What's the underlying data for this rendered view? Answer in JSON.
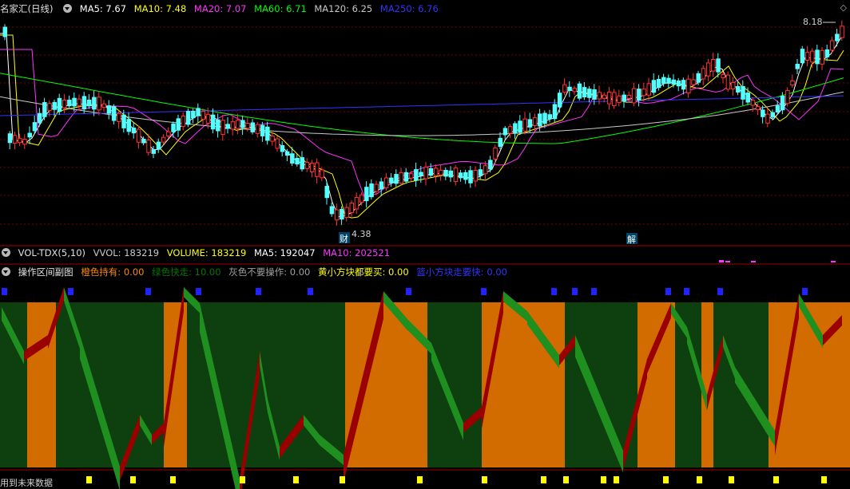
{
  "main_legend": {
    "title": "名家汇(日线)",
    "items": [
      {
        "label": "MA5: 7.67",
        "color": "#ffffff"
      },
      {
        "label": "MA10: 7.48",
        "color": "#ffff00"
      },
      {
        "label": "MA20: 7.07",
        "color": "#ff33ff"
      },
      {
        "label": "MA60: 6.71",
        "color": "#00ff00"
      },
      {
        "label": "MA120: 6.25",
        "color": "#c8c8c8"
      },
      {
        "label": "MA250: 6.76",
        "color": "#3333ff"
      }
    ]
  },
  "vol_legend": {
    "title": "VOL-TDX(5,10)",
    "items": [
      {
        "label": "VVOL: 183219",
        "color": "#c8c8c8"
      },
      {
        "label": "VOLUME: 183219",
        "color": "#ffff00"
      },
      {
        "label": "MA5: 192047",
        "color": "#ffffff"
      },
      {
        "label": "MA10: 202521",
        "color": "#ff33ff"
      }
    ]
  },
  "sub_legend": {
    "title": "操作区间副图",
    "items": [
      {
        "label": "橙色持有: 0.00",
        "color": "#ff8800"
      },
      {
        "label": "绿色快走: 10.00",
        "color": "#008800"
      },
      {
        "label": "灰色不要操作: 0.00",
        "color": "#a0a0a0"
      },
      {
        "label": "黄小方块都要买: 0.00",
        "color": "#ffff00"
      },
      {
        "label": "篮小方块走要快: 0.00",
        "color": "#3333ff"
      }
    ]
  },
  "annotations": {
    "high_label": "8.18",
    "low_label": "4.38",
    "marker_cai": "财",
    "marker_jie": "解",
    "bottom_text": "用到未来数据"
  },
  "colors": {
    "up": "#ff3333",
    "down": "#54ffff",
    "orange_zone": "#d26b00",
    "green_zone": "#0e3f0e",
    "red_ribbon": "#9a0000",
    "green_ribbon": "#1f8f1f"
  }
}
